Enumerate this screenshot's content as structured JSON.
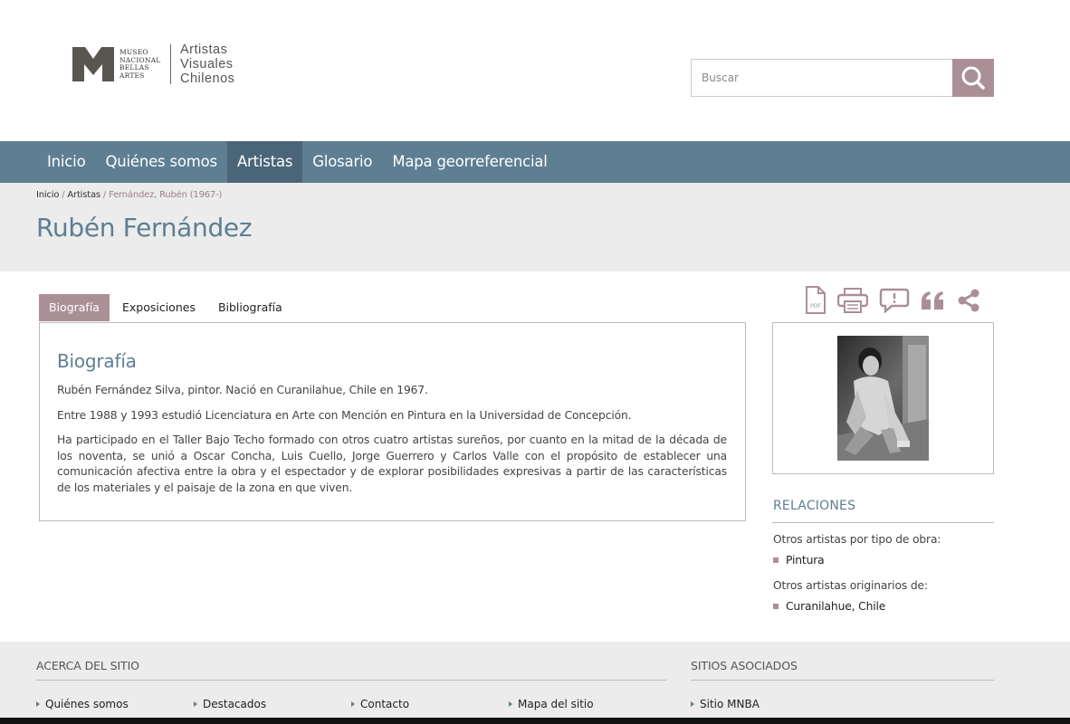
{
  "header": {
    "logo_institution_lines": [
      "MUSEO",
      "NACIONAL",
      "BELLAS",
      "ARTES"
    ],
    "logo_site_lines": [
      "Artistas",
      "Visuales",
      "Chilenos"
    ],
    "search_placeholder": "Buscar",
    "search_icon": "search-icon"
  },
  "nav": {
    "items": [
      {
        "label": "Inicio"
      },
      {
        "label": "Quiénes somos"
      },
      {
        "label": "Artistas",
        "active": true
      },
      {
        "label": "Glosario"
      },
      {
        "label": "Mapa georreferencial"
      }
    ]
  },
  "breadcrumb": {
    "home": "Inicio",
    "sep1": " / ",
    "section": "Artistas",
    "sep2": " / ",
    "current": "Fernández, Rubén (1967-)"
  },
  "page": {
    "title": "Rubén Fernández"
  },
  "tabs": [
    {
      "label": "Biografía",
      "active": true
    },
    {
      "label": "Exposiciones"
    },
    {
      "label": "Bibliografía"
    }
  ],
  "biography": {
    "heading": "Biografía",
    "paragraphs": [
      "Rubén Fernández Silva, pintor. Nació en Curanilahue, Chile en 1967.",
      "Entre 1988 y 1993 estudió Licenciatura en Arte con Mención en Pintura en la Universidad de Concepción.",
      "Ha participado en el Taller Bajo Techo formado con otros cuatro artistas sureños, por cuanto en la mitad de la década de los noventa, se unió a Oscar Concha, Luis Cuello, Jorge Guerrero y Carlos Valle con el propósito de establecer una comunicación afectiva entre la obra y el espectador y de explorar posibilidades expresivas a partir de las características de los materiales y el paisaje de la zona en que viven."
    ]
  },
  "tools": {
    "pdf_label": "PDF",
    "icons": [
      "pdf-icon",
      "print-icon",
      "report-icon",
      "quote-icon",
      "share-icon"
    ]
  },
  "relations": {
    "heading": "RELACIONES",
    "work_type_label": "Otros artistas por tipo de obra:",
    "work_type_link": "Pintura",
    "origin_label": "Otros artistas originarios de:",
    "origin_link": "Curanilahue, Chile"
  },
  "footer": {
    "about_heading": "ACERCA DEL SITIO",
    "about_links": [
      "Quiénes somos",
      "Destacados",
      "Contacto",
      "Mapa del sitio"
    ],
    "associated_heading": "SITIOS ASOCIADOS",
    "associated_links": [
      "Sitio MNBA"
    ]
  },
  "colors": {
    "nav_bg": "#5e7e92",
    "nav_active": "#4a6577",
    "accent": "#ab8f97",
    "title_blue": "#5e7e92"
  }
}
